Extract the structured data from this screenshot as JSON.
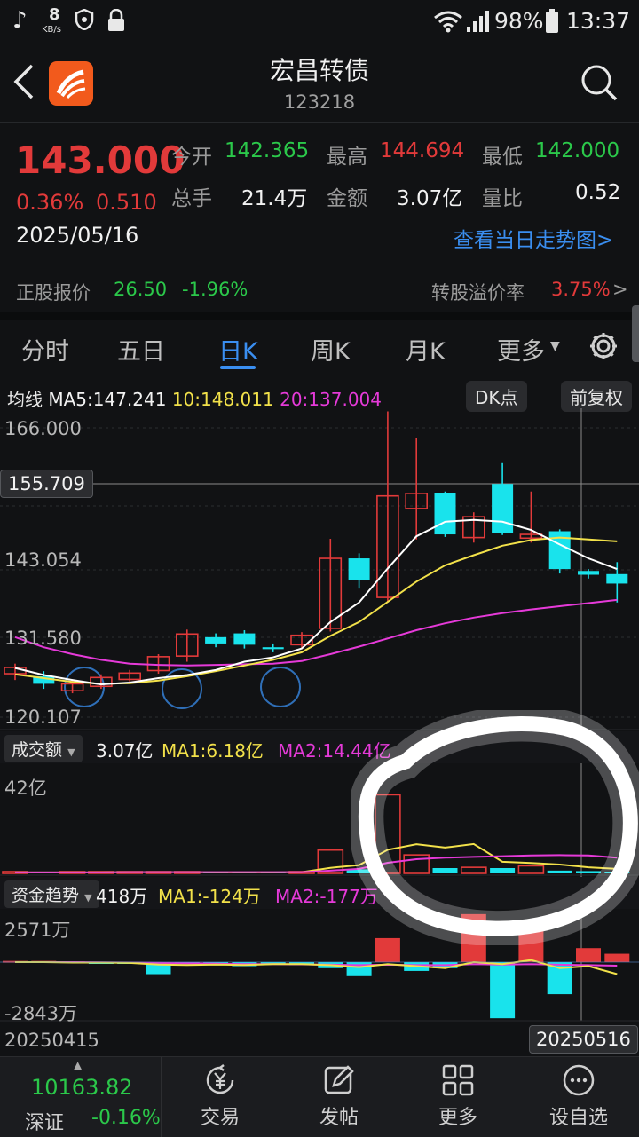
{
  "status_bar": {
    "speed_value": "8",
    "speed_unit": "KB/s",
    "battery": "98%",
    "time": "13:37"
  },
  "header": {
    "title": "宏昌转债",
    "code": "123218"
  },
  "quote": {
    "price": "143.000",
    "change_pct": "0.36%",
    "change_abs": "0.510",
    "date": "2025/05/16",
    "open_label": "今开",
    "open": "142.365",
    "high_label": "最高",
    "high": "144.694",
    "low_label": "最低",
    "low": "142.000",
    "volume_label": "总手",
    "volume": "21.4万",
    "amount_label": "金额",
    "amount": "3.07亿",
    "vol_ratio_label": "量比",
    "vol_ratio": "0.52",
    "intraday_link": "查看当日走势图>",
    "stock_label": "正股报价",
    "stock_price": "26.50",
    "stock_change": "-1.96%",
    "premium_label": "转股溢价率",
    "premium": "3.75%",
    "premium_arrow": ">"
  },
  "tabs": [
    "分时",
    "五日",
    "日K",
    "周K",
    "月K",
    "更多"
  ],
  "active_tab": 2,
  "ma_bar": {
    "label": "均线",
    "ma5": "MA5:147.241",
    "ma10": "10:148.011",
    "ma20": "20:137.004",
    "dk_button": "DK点",
    "fq_button": "前复权"
  },
  "price_axis": {
    "top": "166.000",
    "crosshair": "155.709",
    "mid": "143.054",
    "low": "131.580",
    "bottom": "120.107"
  },
  "volume_bar": {
    "label": "成交额",
    "value": "3.07亿",
    "ma1": "MA1:6.18亿",
    "ma2": "MA2:14.44亿",
    "axis_top": "42亿"
  },
  "fund_bar": {
    "label": "资金趋势",
    "value": "418万",
    "ma1": "MA1:-124万",
    "ma2": "MA2:-177万",
    "axis_top": "2571万",
    "axis_bottom": "-2843万"
  },
  "date_axis": {
    "start": "20250415",
    "end": "20250516"
  },
  "bottom_nav": {
    "index_value": "10163.82",
    "index_name": "深证",
    "index_change": "-0.16%",
    "items": [
      "交易",
      "发帖",
      "更多",
      "设自选"
    ]
  },
  "colors": {
    "up": "#e23a3a",
    "down": "#19e3ec",
    "ma5": "#ffffff",
    "ma10": "#f2e14a",
    "ma20": "#e63ad9",
    "accent": "#3a8ef0"
  },
  "chart_data": {
    "type": "candlestick",
    "y_range": [
      120.107,
      166.0
    ],
    "candles": [
      {
        "o": 127.0,
        "c": 128.0,
        "h": 128.6,
        "l": 126.0
      },
      {
        "o": 126.6,
        "c": 125.4,
        "h": 127.4,
        "l": 124.6
      },
      {
        "o": 124.3,
        "c": 125.4,
        "h": 126.1,
        "l": 123.9
      },
      {
        "o": 125.0,
        "c": 126.4,
        "h": 126.9,
        "l": 124.6
      },
      {
        "o": 126.1,
        "c": 127.1,
        "h": 127.6,
        "l": 125.6
      },
      {
        "o": 127.5,
        "c": 129.7,
        "h": 130.1,
        "l": 127.0
      },
      {
        "o": 129.8,
        "c": 133.3,
        "h": 134.0,
        "l": 128.9
      },
      {
        "o": 132.8,
        "c": 131.8,
        "h": 133.4,
        "l": 131.2
      },
      {
        "o": 133.4,
        "c": 131.6,
        "h": 133.9,
        "l": 131.0
      },
      {
        "o": 131.2,
        "c": 130.9,
        "h": 131.8,
        "l": 130.4
      },
      {
        "o": 131.6,
        "c": 133.1,
        "h": 133.6,
        "l": 130.9
      },
      {
        "o": 134.2,
        "c": 145.3,
        "h": 148.4,
        "l": 133.7
      },
      {
        "o": 145.3,
        "c": 141.9,
        "h": 146.1,
        "l": 140.5
      },
      {
        "o": 139.1,
        "c": 155.2,
        "h": 168.6,
        "l": 138.3
      },
      {
        "o": 153.2,
        "c": 155.6,
        "h": 164.4,
        "l": 148.3
      },
      {
        "o": 155.6,
        "c": 149.1,
        "h": 155.9,
        "l": 148.7
      },
      {
        "o": 148.6,
        "c": 151.9,
        "h": 152.6,
        "l": 147.8
      },
      {
        "o": 157.1,
        "c": 149.3,
        "h": 160.4,
        "l": 149.0
      },
      {
        "o": 148.5,
        "c": 149.1,
        "h": 155.9,
        "l": 147.8
      },
      {
        "o": 149.6,
        "c": 143.6,
        "h": 149.9,
        "l": 142.9
      },
      {
        "o": 143.3,
        "c": 142.7,
        "h": 143.6,
        "l": 142.1
      },
      {
        "o": 142.8,
        "c": 141.3,
        "h": 144.7,
        "l": 138.3
      }
    ],
    "ma5": [
      127.9,
      126.8,
      126.0,
      125.3,
      125.6,
      126.3,
      126.8,
      127.6,
      128.9,
      129.6,
      131.0,
      135.2,
      138.3,
      143.7,
      148.8,
      151.1,
      151.4,
      151.1,
      149.8,
      147.5,
      145.3,
      143.6
    ],
    "ma10": [
      126.9,
      126.3,
      125.7,
      125.4,
      125.5,
      125.9,
      126.6,
      127.4,
      128.3,
      129.2,
      130.4,
      133.0,
      135.2,
      138.4,
      141.6,
      144.2,
      145.8,
      147.3,
      148.2,
      148.6,
      148.3,
      148.0
    ],
    "ma20": [
      132.8,
      131.2,
      130.1,
      129.2,
      128.6,
      128.4,
      128.3,
      128.4,
      128.5,
      128.6,
      129.0,
      130.1,
      131.3,
      132.6,
      133.9,
      135.0,
      135.9,
      136.6,
      137.2,
      137.7,
      138.2,
      138.7
    ],
    "turnover_yi": [
      0.5,
      0.4,
      0.3,
      0.4,
      0.6,
      0.6,
      0.3,
      0.3,
      0.3,
      0.4,
      0.6,
      9.2,
      1.6,
      31.0,
      7.3,
      2.1,
      2.4,
      2.1,
      3.0,
      1.1,
      0.9,
      0.51
    ],
    "turnover_ma1_yi": [
      0.4,
      0.4,
      0.4,
      0.4,
      0.5,
      0.5,
      0.5,
      0.4,
      0.4,
      0.4,
      0.5,
      2.2,
      3.3,
      9.3,
      11.5,
      10.2,
      11.6,
      4.6,
      4.1,
      3.5,
      2.4,
      1.8
    ],
    "turnover_ma2_yi": [
      0.4,
      0.4,
      0.4,
      0.4,
      0.5,
      0.5,
      0.5,
      0.5,
      0.5,
      0.5,
      0.5,
      1.1,
      1.8,
      4.2,
      5.6,
      6.2,
      6.5,
      6.8,
      7.1,
      7.2,
      7.1,
      6.2
    ],
    "fund_wan": [
      60,
      60,
      40,
      -20,
      -40,
      -600,
      -60,
      -60,
      -200,
      -100,
      -150,
      -300,
      -700,
      1200,
      -440,
      -300,
      2400,
      -2800,
      1700,
      -1600,
      700,
      418
    ],
    "fund_ma1_wan": [
      0,
      0,
      -20,
      -20,
      -40,
      -120,
      -140,
      -120,
      -140,
      -100,
      -100,
      -150,
      -250,
      -100,
      -200,
      -300,
      0,
      -100,
      100,
      -300,
      -200,
      -600
    ],
    "fund_ma2_wan": [
      0,
      0,
      0,
      -10,
      -20,
      -40,
      -60,
      -80,
      -100,
      -100,
      -110,
      -130,
      -150,
      -130,
      -150,
      -150,
      -100,
      -120,
      -100,
      -130,
      -150,
      -177
    ]
  }
}
